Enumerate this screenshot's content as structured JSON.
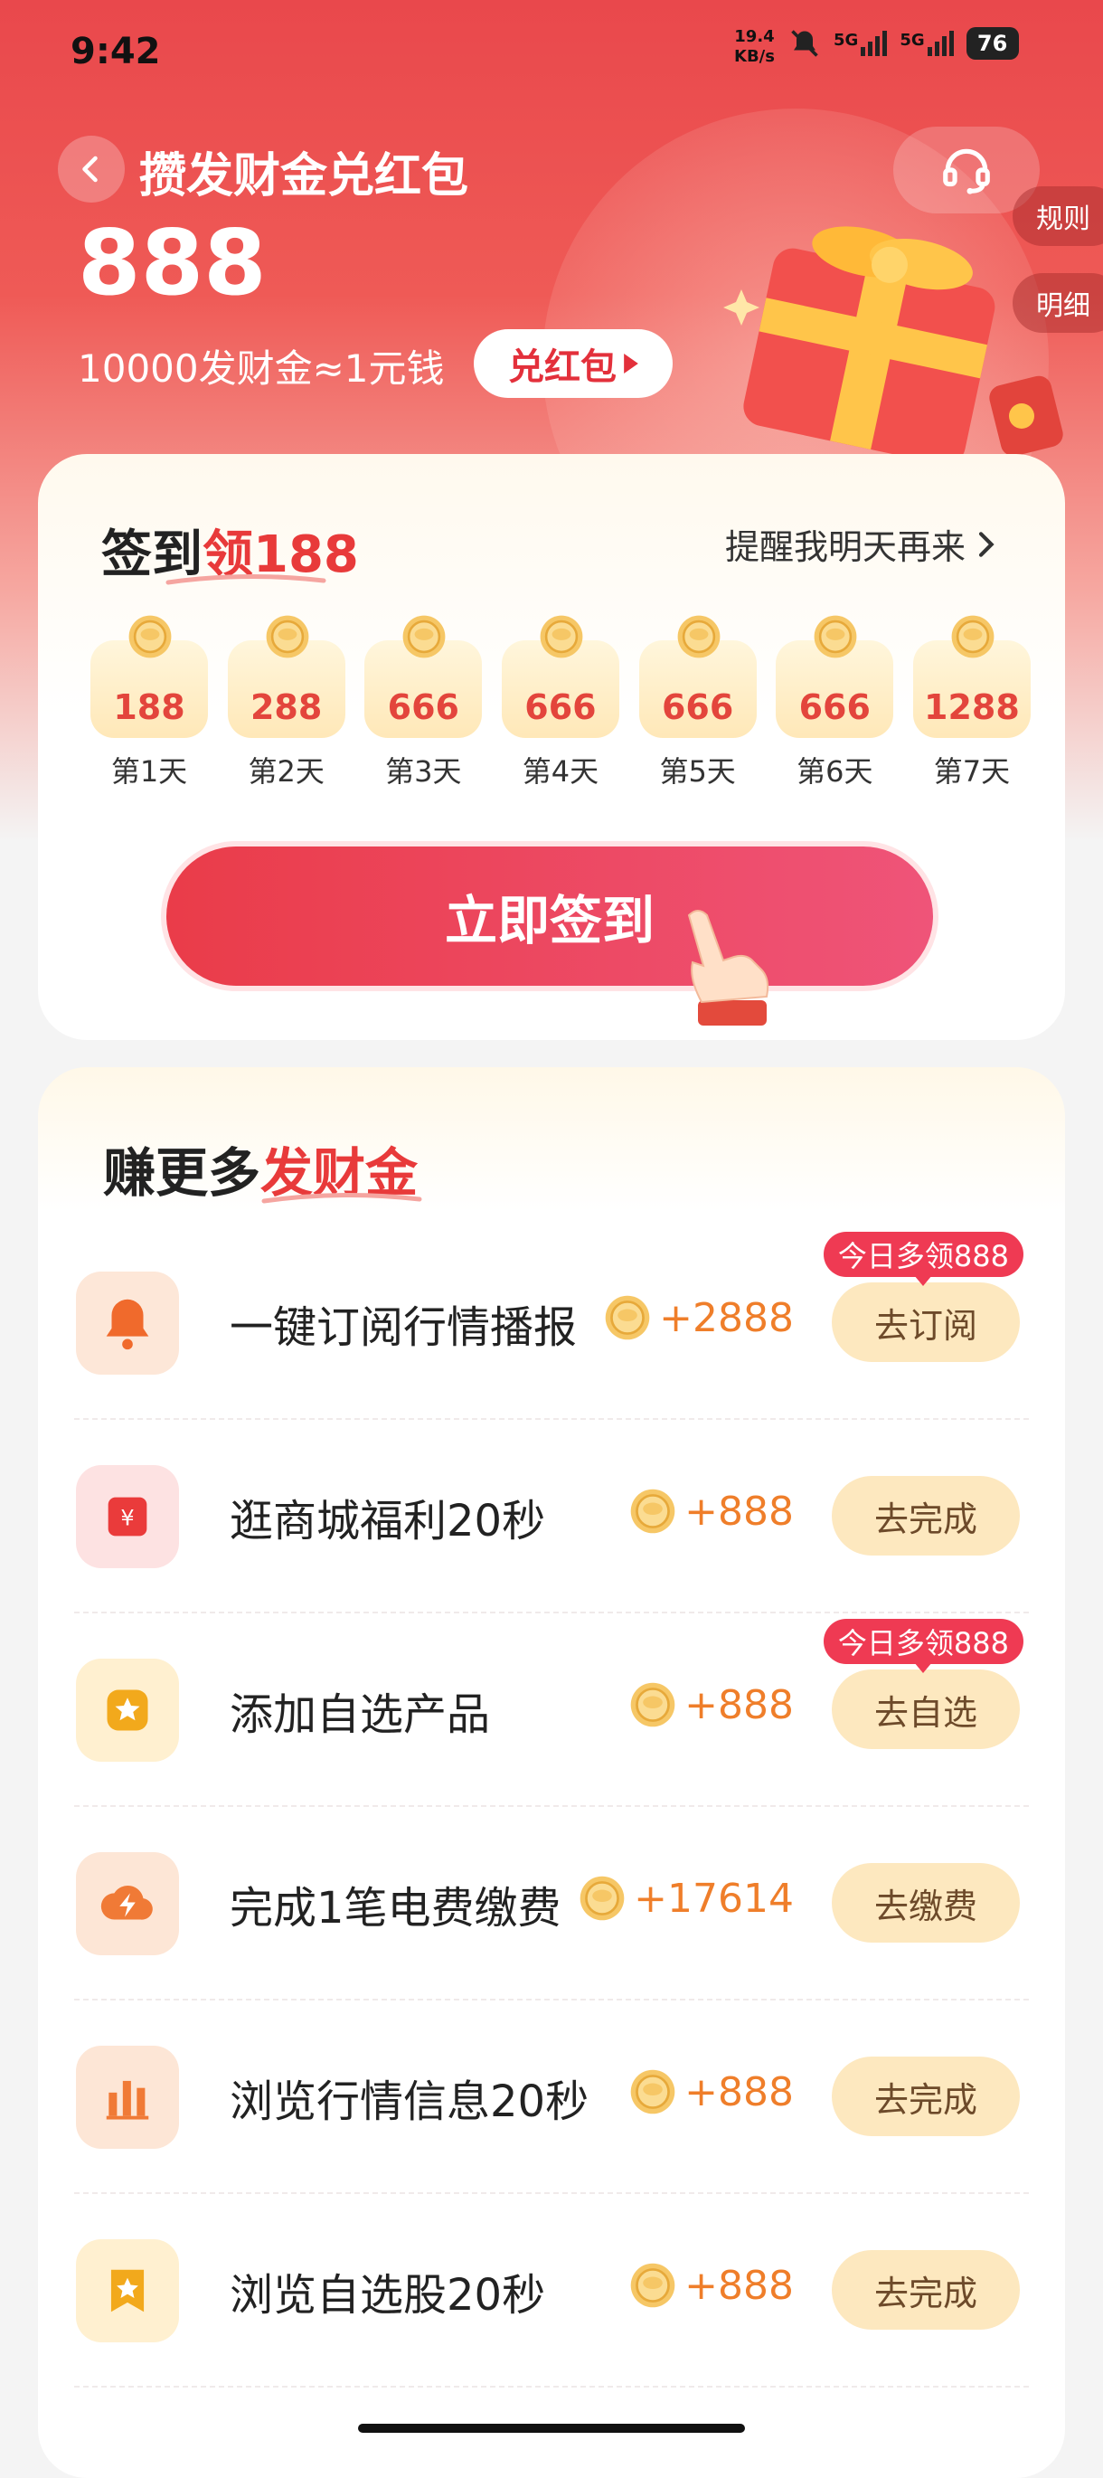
{
  "status_bar": {
    "time": "9:42",
    "net_speed_value": "19.4",
    "net_speed_unit": "KB/s",
    "network_1": "5G",
    "network_2": "5G",
    "battery": "76"
  },
  "header": {
    "title": "攒发财金兑红包",
    "balance": "888",
    "rate_text": "10000发财金≈1元钱",
    "exchange_label": "兑红包",
    "side_tabs": [
      "规则",
      "明细"
    ]
  },
  "checkin": {
    "title_prefix": "签到",
    "title_highlight": "领",
    "title_number": "188",
    "remind_label": "提醒我明天再来",
    "days": [
      {
        "value": "188",
        "label": "第1天"
      },
      {
        "value": "288",
        "label": "第2天"
      },
      {
        "value": "666",
        "label": "第3天"
      },
      {
        "value": "666",
        "label": "第4天"
      },
      {
        "value": "666",
        "label": "第5天"
      },
      {
        "value": "666",
        "label": "第6天"
      },
      {
        "value": "1288",
        "label": "第7天"
      }
    ],
    "sign_button": "立即签到"
  },
  "earn": {
    "title_prefix": "赚更多",
    "title_highlight": "发财金",
    "tasks": [
      {
        "name": "一键订阅行情播报",
        "reward": "+2888",
        "button": "去订阅",
        "badge": "今日多领888",
        "icon": "bell-icon",
        "icon_bg": "#fde7d8",
        "icon_color": "#f06a2c"
      },
      {
        "name": "逛商城福利20秒",
        "reward": "+888",
        "button": "去完成",
        "badge": "",
        "icon": "shopping-bag-icon",
        "icon_bg": "#fde2e2",
        "icon_color": "#ea3b3b"
      },
      {
        "name": "添加自选产品",
        "reward": "+888",
        "button": "去自选",
        "badge": "今日多领888",
        "icon": "star-icon",
        "icon_bg": "#fff0d0",
        "icon_color": "#f2a91c"
      },
      {
        "name": "完成1笔电费缴费",
        "reward": "+17614",
        "button": "去缴费",
        "badge": "",
        "icon": "lightning-cloud-icon",
        "icon_bg": "#fde6d6",
        "icon_color": "#f07a36"
      },
      {
        "name": "浏览行情信息20秒",
        "reward": "+888",
        "button": "去完成",
        "badge": "",
        "icon": "bar-chart-icon",
        "icon_bg": "#fde6d6",
        "icon_color": "#f07a36"
      },
      {
        "name": "浏览自选股20秒",
        "reward": "+888",
        "button": "去完成",
        "badge": "",
        "icon": "bookmark-star-icon",
        "icon_bg": "#fff0d0",
        "icon_color": "#f2a91c"
      }
    ]
  },
  "colors": {
    "brand_red": "#e83a3a",
    "reward_orange": "#ef7e2a",
    "button_cream": "#fde8bf"
  }
}
